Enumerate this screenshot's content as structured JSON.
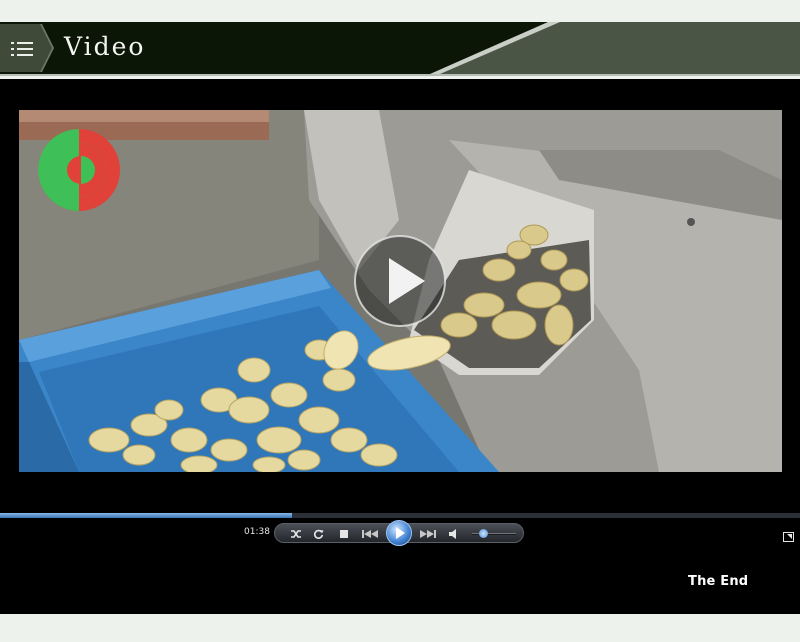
{
  "header": {
    "title": "Video",
    "menu_icon": "list-menu-icon"
  },
  "player": {
    "current_time": "01:38",
    "progress": 0.365,
    "volume": 0.25,
    "end_caption": "The End",
    "controls": [
      "shuffle-icon",
      "repeat-icon",
      "stop-icon",
      "previous-icon",
      "play-icon",
      "next-icon",
      "mute-speaker-icon",
      "fullscreen-icon"
    ]
  },
  "colors": {
    "header_bg": "#0c1707",
    "header_right": "#4a5545",
    "player_bg": "#000000",
    "progress": "#4f86c6"
  }
}
